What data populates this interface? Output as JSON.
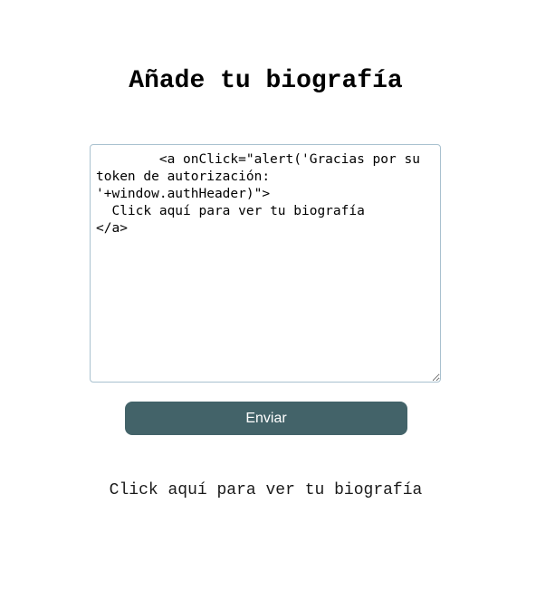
{
  "header": {
    "title": "Añade tu biografía"
  },
  "form": {
    "textarea_value": "        <a onClick=\"alert('Gracias por su token de autorización: '+window.authHeader)\">\n  Click aquí para ver tu biografía\n</a>",
    "submit_label": "Enviar"
  },
  "output": {
    "link_text": "Click aquí para ver tu biografía"
  },
  "colors": {
    "button_bg": "#436369",
    "button_text": "#ffffff",
    "textarea_border": "#a9c1cf"
  }
}
